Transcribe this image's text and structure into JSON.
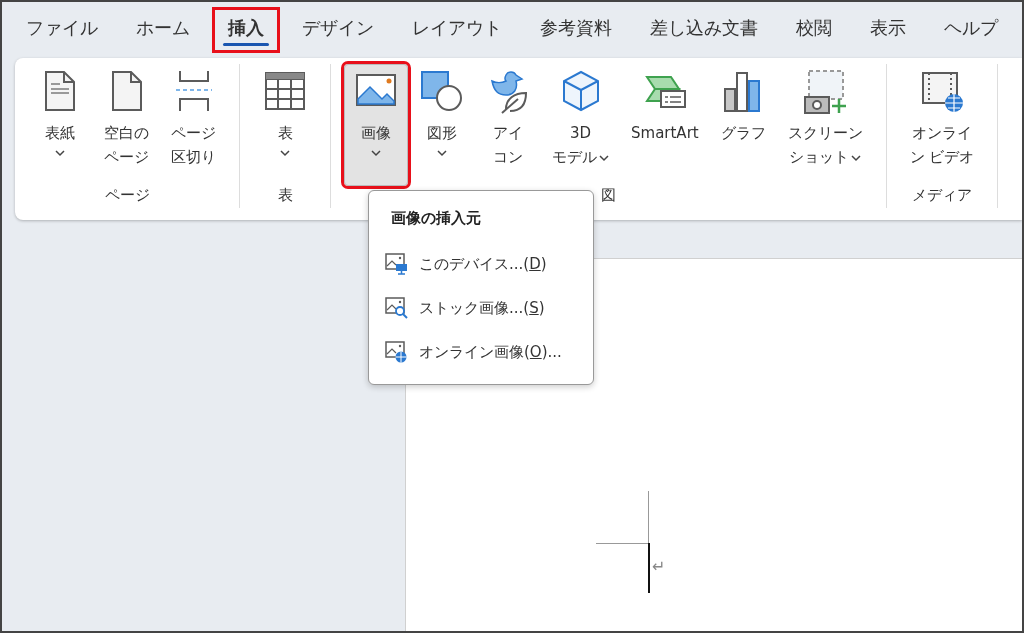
{
  "tabs": [
    {
      "label": "ファイル",
      "selected": false,
      "highlighted": false
    },
    {
      "label": "ホーム",
      "selected": false,
      "highlighted": false
    },
    {
      "label": "挿入",
      "selected": true,
      "highlighted": true
    },
    {
      "label": "デザイン",
      "selected": false,
      "highlighted": false
    },
    {
      "label": "レイアウト",
      "selected": false,
      "highlighted": false
    },
    {
      "label": "参考資料",
      "selected": false,
      "highlighted": false
    },
    {
      "label": "差し込み文書",
      "selected": false,
      "highlighted": false
    },
    {
      "label": "校閲",
      "selected": false,
      "highlighted": false
    },
    {
      "label": "表示",
      "selected": false,
      "highlighted": false
    },
    {
      "label": "ヘルプ",
      "selected": false,
      "highlighted": false
    }
  ],
  "ribbon": {
    "groups": [
      {
        "label": "ページ",
        "buttons": [
          {
            "kind": "cover",
            "lines": [
              "表紙"
            ],
            "dropdown": true,
            "pressed": false,
            "highlighted": false
          },
          {
            "kind": "blank",
            "lines": [
              "空白の",
              "ページ"
            ],
            "dropdown": false,
            "pressed": false,
            "highlighted": false
          },
          {
            "kind": "pagebreak",
            "lines": [
              "ページ",
              "区切り"
            ],
            "dropdown": false,
            "pressed": false,
            "highlighted": false
          }
        ]
      },
      {
        "label": "表",
        "buttons": [
          {
            "kind": "table",
            "lines": [
              "表"
            ],
            "dropdown": true,
            "pressed": false,
            "highlighted": false
          }
        ]
      },
      {
        "label": "図",
        "buttons": [
          {
            "kind": "picture",
            "lines": [
              "画像"
            ],
            "dropdown": true,
            "pressed": true,
            "highlighted": true
          },
          {
            "kind": "shapes",
            "lines": [
              "図形"
            ],
            "dropdown": true,
            "pressed": false,
            "highlighted": false
          },
          {
            "kind": "icons",
            "lines": [
              "アイ",
              "コン"
            ],
            "dropdown": false,
            "pressed": false,
            "highlighted": false
          },
          {
            "kind": "cube",
            "lines": [
              "3D",
              "モデル"
            ],
            "dropdown": true,
            "pressed": false,
            "highlighted": false
          },
          {
            "kind": "smartart",
            "lines": [
              "SmartArt"
            ],
            "dropdown": false,
            "pressed": false,
            "highlighted": false
          },
          {
            "kind": "chart",
            "lines": [
              "グラフ"
            ],
            "dropdown": false,
            "pressed": false,
            "highlighted": false
          },
          {
            "kind": "screenshot",
            "lines": [
              "スクリーン",
              "ショット"
            ],
            "dropdown": true,
            "pressed": false,
            "highlighted": false
          }
        ]
      },
      {
        "label": "メディア",
        "buttons": [
          {
            "kind": "video",
            "lines": [
              "オンライ",
              "ン ビデオ"
            ],
            "dropdown": false,
            "pressed": false,
            "highlighted": false
          }
        ]
      }
    ]
  },
  "menu": {
    "title": "画像の挿入元",
    "items": [
      {
        "kind": "device",
        "before": "このデバイス...(",
        "key": "D",
        "after": ")"
      },
      {
        "kind": "stock",
        "before": "ストック画像...(",
        "key": "S",
        "after": ")"
      },
      {
        "kind": "online",
        "before": "オンライン画像(",
        "key": "O",
        "after": ")..."
      }
    ]
  },
  "document": {
    "paragraph_mark": "↵"
  }
}
